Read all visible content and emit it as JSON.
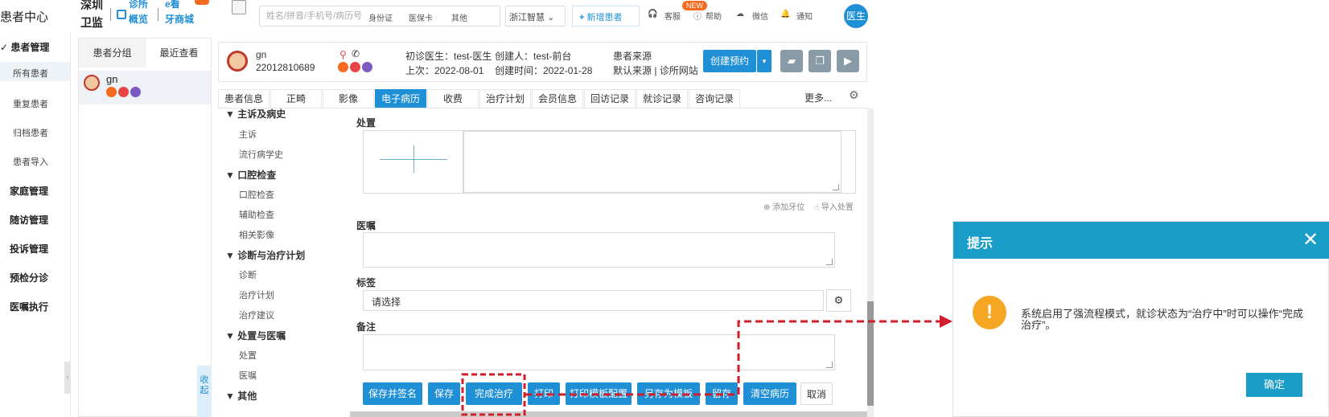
{
  "header": {
    "app_title": "患者中心",
    "brand_line1": "深圳",
    "brand_line2": "卫监",
    "link_clinic_line1": "诊所",
    "link_clinic_line2": "概览",
    "link_shop_line1": "e看",
    "link_shop_line2": "牙商城",
    "search_placeholder": "姓名/拼音/手机号/病历号",
    "search_options": [
      "身份证",
      "医保卡",
      "其他"
    ],
    "clinic_name": "浙江智慧",
    "add_patient": "新增患者",
    "tools": {
      "service": "客服",
      "help": "帮助",
      "wechat": "微信",
      "notify": "通知"
    },
    "new_badge": "NEW",
    "avatar_text": "医生"
  },
  "leftnav": {
    "sections": [
      {
        "label": "患者管理",
        "items": [
          {
            "label": "所有患者",
            "active": true
          },
          {
            "label": "重复患者"
          },
          {
            "label": "归档患者"
          },
          {
            "label": "患者导入"
          }
        ]
      },
      {
        "label": "家庭管理"
      },
      {
        "label": "随访管理"
      },
      {
        "label": "投诉管理"
      },
      {
        "label": "预检分诊"
      },
      {
        "label": "医嘱执行"
      }
    ]
  },
  "patient_list": {
    "tabs": [
      "患者分组",
      "最近查看"
    ],
    "items": [
      {
        "name": "gn"
      }
    ]
  },
  "patient_header": {
    "name": "gn",
    "id": "22012810689",
    "first_doctor": "初诊医生：test-医生",
    "last_visit": "上次：2022-08-01",
    "creator": "创建人：test-前台",
    "created_at": "创建时间：2022-01-28",
    "source_label": "患者来源",
    "source_value": "默认来源 | 诊所网站",
    "create_appt": "创建预约"
  },
  "tabs": [
    "患者信息",
    "正畸",
    "影像",
    "电子病历",
    "收费",
    "治疗计划",
    "会员信息",
    "回访记录",
    "就诊记录",
    "咨询记录"
  ],
  "active_tab": "电子病历",
  "tabs_more": "更多...",
  "outline": {
    "groups": [
      {
        "title": "主诉及病史",
        "items": [
          "主诉",
          "流行病学史"
        ]
      },
      {
        "title": "口腔检查",
        "items": [
          "口腔检查",
          "辅助检查",
          "相关影像"
        ]
      },
      {
        "title": "诊断与治疗计划",
        "items": [
          "诊断",
          "治疗计划",
          "治疗建议"
        ]
      },
      {
        "title": "处置与医嘱",
        "items": [
          "处置",
          "医嘱"
        ]
      },
      {
        "title": "其他",
        "items": []
      }
    ],
    "collapse": "收起"
  },
  "form": {
    "disposal_label": "处置",
    "add_tooth": "添加牙位",
    "import_disposal": "导入处置",
    "advice_label": "医嘱",
    "tag_label": "标签",
    "tag_placeholder": "请选择",
    "remark_label": "备注"
  },
  "actions": [
    "保存并签名",
    "保存",
    "完成治疗",
    "打印",
    "打印模板配置",
    "另存为模板",
    "留存",
    "清空病历",
    "取消"
  ],
  "dialog": {
    "title": "提示",
    "message": "系统启用了强流程模式，就诊状态为“治疗中”时可以操作“完成治疗”。",
    "ok": "确定"
  },
  "colors": {
    "primary": "#1f8fd6",
    "dialog_header": "#1a9ec9",
    "warning": "#f5a623",
    "annotation": "#d01f2a"
  }
}
